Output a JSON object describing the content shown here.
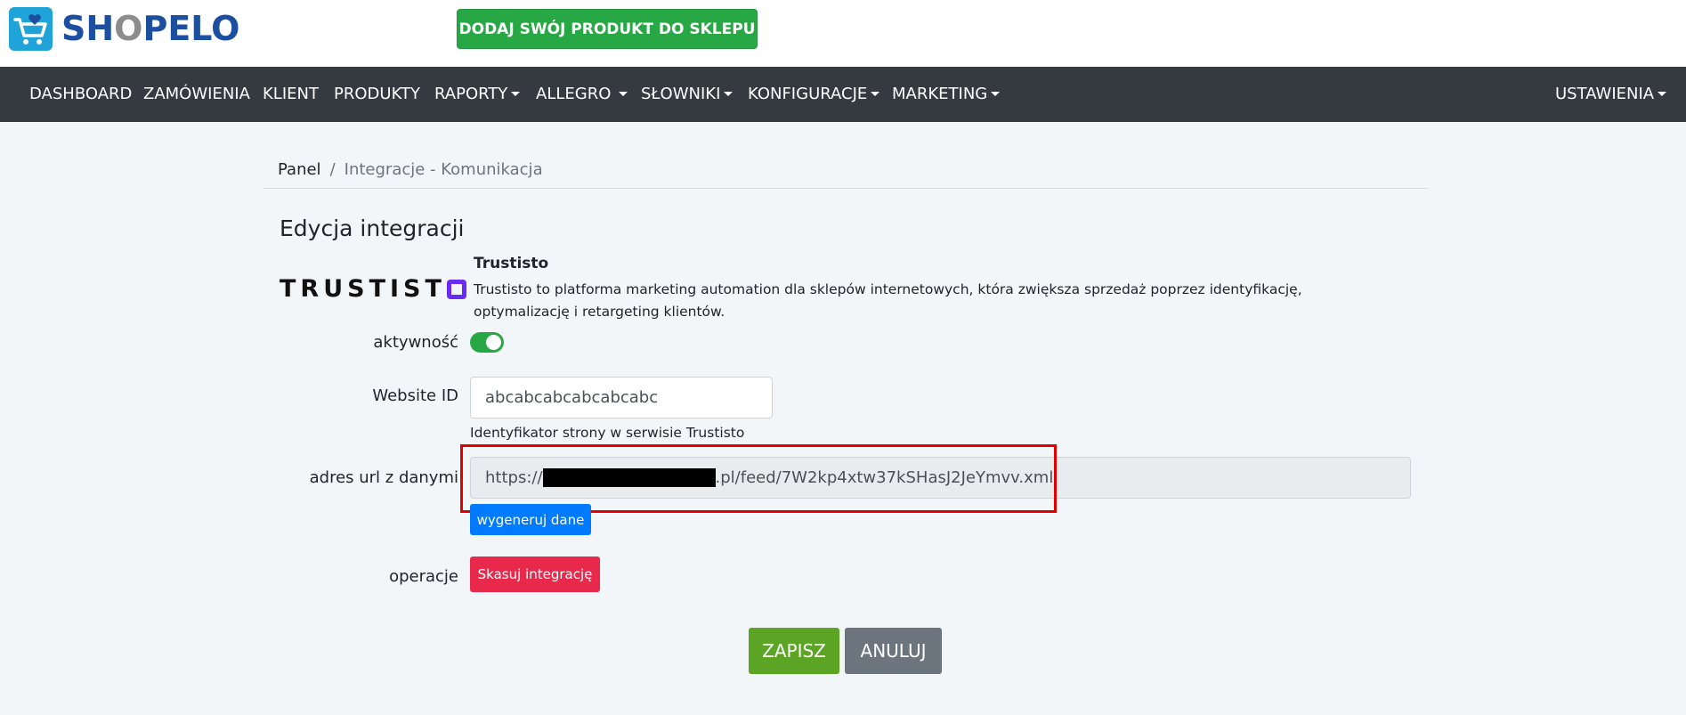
{
  "header": {
    "logo_text_a": "SH",
    "logo_text_o": "O",
    "logo_text_b": "PELO",
    "promo_button": "DODAJ SWÓJ PRODUKT DO SKLEPU",
    "logo_icon": "shopping-cart-icon"
  },
  "nav": {
    "dashboard": "DASHBOARD",
    "orders": "ZAMÓWIENIA",
    "client": "KLIENT",
    "products": "PRODUKTY",
    "reports": "RAPORTY",
    "allegro": "ALLEGRO",
    "dictionaries": "SŁOWNIKI",
    "configurations": "KONFIGURACJE",
    "marketing": "MARKETING",
    "settings": "USTAWIENIA"
  },
  "breadcrumb": {
    "home": "Panel",
    "separator": "/",
    "current": "Integracje - Komunikacja"
  },
  "page": {
    "title": "Edycja integracji"
  },
  "integration": {
    "logo_text": "TRUSTIST",
    "name": "Trustisto",
    "description": "Trustisto to platforma marketing automation dla sklepów internetowych, która zwiększa sprzedaż poprzez identyfikację, optymalizację i retargeting klientów."
  },
  "form": {
    "activity_label": "aktywność",
    "activity_enabled": true,
    "website_id_label": "Website ID",
    "website_id_value": "abcabcabcabcabcabc",
    "website_id_help": "Identyfikator strony w serwisie Trustisto",
    "url_label": "adres url z danymi",
    "url_prefix": "https://",
    "url_suffix": ".pl/feed/7W2kp4xtw37kSHasJ2JeYmvv.xml",
    "generate_button": "wygeneruj dane",
    "operations_label": "operacje",
    "delete_button": "Skasuj integrację"
  },
  "actions": {
    "save": "ZAPISZ",
    "cancel": "ANULUJ"
  },
  "colors": {
    "navbar": "#343a40",
    "primary": "#007bff",
    "success": "#28a745",
    "danger": "#e8294c",
    "highlight": "#e30000"
  }
}
